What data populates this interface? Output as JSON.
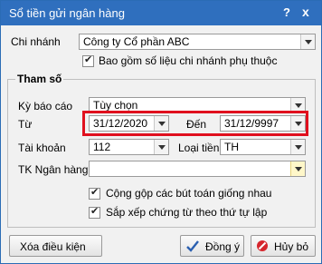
{
  "window": {
    "title": "Sổ tiền gửi ngân hàng",
    "help_label": "?",
    "close_label": "x"
  },
  "branch": {
    "label": "Chi nhánh",
    "value": "Công ty Cổ phần ABC"
  },
  "include_sub_branches": {
    "label": "Bao gồm số liệu chi nhánh phụ thuộc",
    "checked": true
  },
  "params": {
    "title": "Tham số",
    "period": {
      "label": "Kỳ báo cáo",
      "value": "Tùy chọn"
    },
    "from": {
      "label": "Từ",
      "value": "31/12/2020"
    },
    "to": {
      "label": "Đến",
      "value": "31/12/9997"
    },
    "account": {
      "label": "Tài khoản",
      "value": "112"
    },
    "currency": {
      "label": "Loại tiền",
      "value": "TH"
    },
    "bank_account": {
      "label": "TK Ngân hàng",
      "value": ""
    },
    "merge_entries": {
      "label": "Cộng gộp các bút toán giống nhau",
      "checked": true
    },
    "sort_by_date": {
      "label": "Sắp xếp chứng từ theo thứ tự lập",
      "checked": true
    }
  },
  "buttons": {
    "clear": "Xóa điều kiện",
    "ok": "Đồng ý",
    "cancel": "Hủy bỏ"
  },
  "colors": {
    "titlebar": "#2f6fbe",
    "highlight": "#e0101e"
  }
}
